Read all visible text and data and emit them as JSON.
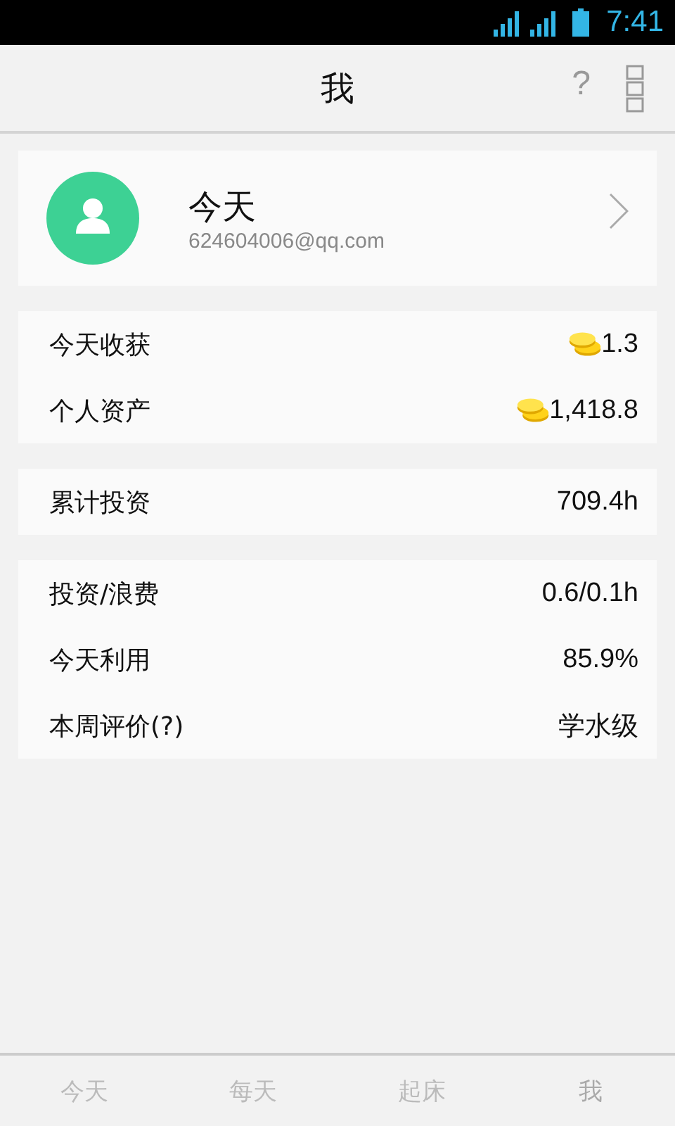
{
  "status_bar": {
    "time": "7:41"
  },
  "header": {
    "title": "我",
    "help": "?"
  },
  "profile": {
    "name": "今天",
    "email": "624604006@qq.com"
  },
  "sections": [
    {
      "rows": [
        {
          "label": "今天收获",
          "value": "1.3",
          "kind": "coin"
        },
        {
          "label": "个人资产",
          "value": "1,418.8",
          "kind": "coin"
        }
      ]
    },
    {
      "rows": [
        {
          "label": "累计投资",
          "value": "709.4h",
          "kind": "plain"
        }
      ]
    },
    {
      "rows": [
        {
          "label": "投资/浪费",
          "value": "0.6/0.1h",
          "kind": "plain"
        },
        {
          "label": "今天利用",
          "value": "85.9%",
          "kind": "plain"
        },
        {
          "label": "本周评价(?)",
          "value": "学水级",
          "kind": "plain"
        }
      ]
    }
  ],
  "tabs": [
    {
      "label": "今天",
      "selected": false
    },
    {
      "label": "每天",
      "selected": false
    },
    {
      "label": "起床",
      "selected": false
    },
    {
      "label": "我",
      "selected": true
    }
  ]
}
